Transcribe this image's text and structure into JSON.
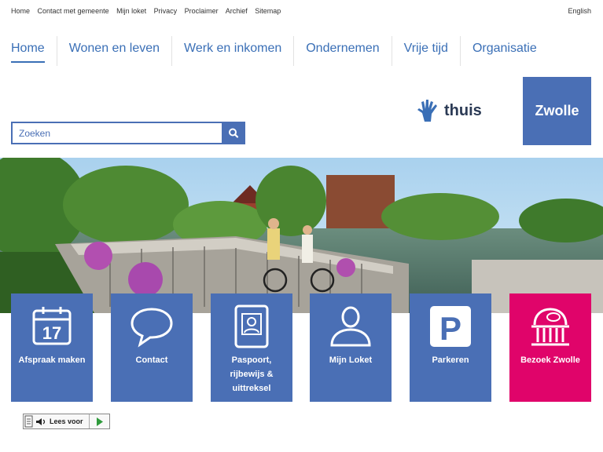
{
  "topnav": [
    "Home",
    "Contact met gemeente",
    "Mijn loket",
    "Privacy",
    "Proclaimer",
    "Archief",
    "Sitemap"
  ],
  "language": "English",
  "mainnav": [
    "Home",
    "Wonen en leven",
    "Werk en inkomen",
    "Ondernemen",
    "Vrije tijd",
    "Organisatie"
  ],
  "search": {
    "placeholder": "Zoeken"
  },
  "logo": {
    "thuis": "thuis",
    "zwolle": "Zwolle"
  },
  "tiles": [
    {
      "label": "Afspraak maken",
      "icon": "calendar-icon",
      "day": "17"
    },
    {
      "label": "Contact",
      "icon": "speech-bubble-icon"
    },
    {
      "label": "Paspoort, rijbewijs & uittreksel",
      "icon": "id-card-icon"
    },
    {
      "label": "Mijn Loket",
      "icon": "user-icon"
    },
    {
      "label": "Parkeren",
      "icon": "parking-icon",
      "letter": "P"
    },
    {
      "label": "Bezoek Zwolle",
      "icon": "building-icon"
    }
  ],
  "readspeaker": {
    "label": "Lees voor"
  },
  "colors": {
    "brand": "#4a6fb5",
    "accent": "#e0046a",
    "nav": "#3a6fb6"
  }
}
